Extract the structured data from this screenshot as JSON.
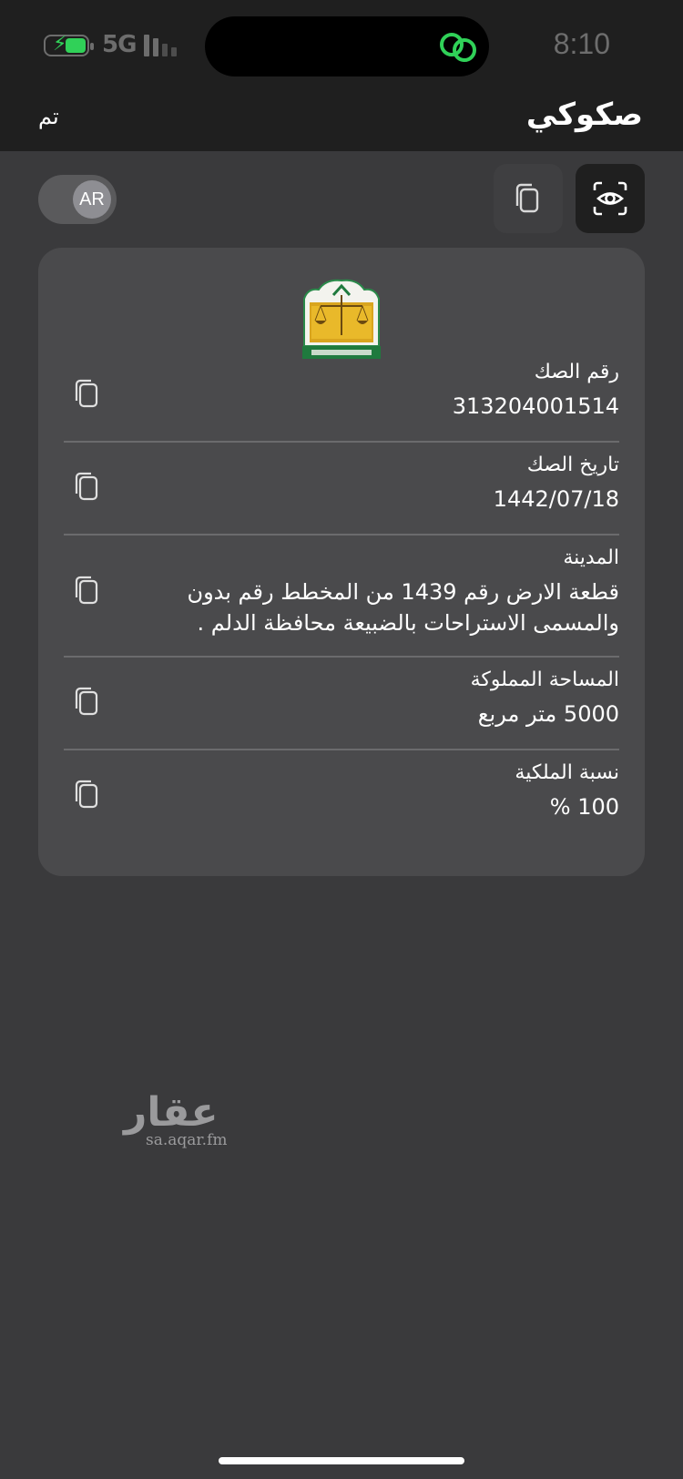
{
  "status_bar": {
    "time": "8:10",
    "network": "5G",
    "battery_level": 0.5,
    "battery_color": "#30d158",
    "icons": [
      "battery-charging-icon",
      "signal-bars-icon",
      "linked-rings-icon"
    ]
  },
  "nav": {
    "title": "صكوكي",
    "done_label": "تم"
  },
  "toolbar": {
    "lang_label": "AR",
    "icons": [
      "copy-icon",
      "eye-scan-icon"
    ]
  },
  "card": {
    "emblem": "ministry-of-justice-emblem",
    "fields": [
      {
        "label": "رقم الصك",
        "value": "313204001514"
      },
      {
        "label": "تاريخ الصك",
        "value": "1442/07/18"
      },
      {
        "label": "المدينة",
        "value_line1": "قطعة الارض  رقم 1439 من المخطط رقم  بدون",
        "value_line2": "والمسمى الاستراحات بالضبيعة  محافظة الدلم ."
      },
      {
        "label": "المساحة المملوكة",
        "value": "5000 متر مربع"
      },
      {
        "label": "نسبة الملكية",
        "value": "100 %"
      }
    ]
  },
  "watermark": {
    "name": "عقار",
    "url": "sa.aqar.fm"
  },
  "colors": {
    "background": "#3a3a3c",
    "bar": "#1f1f1f",
    "card": "#4a4a4c",
    "accent_green": "#30d158"
  }
}
